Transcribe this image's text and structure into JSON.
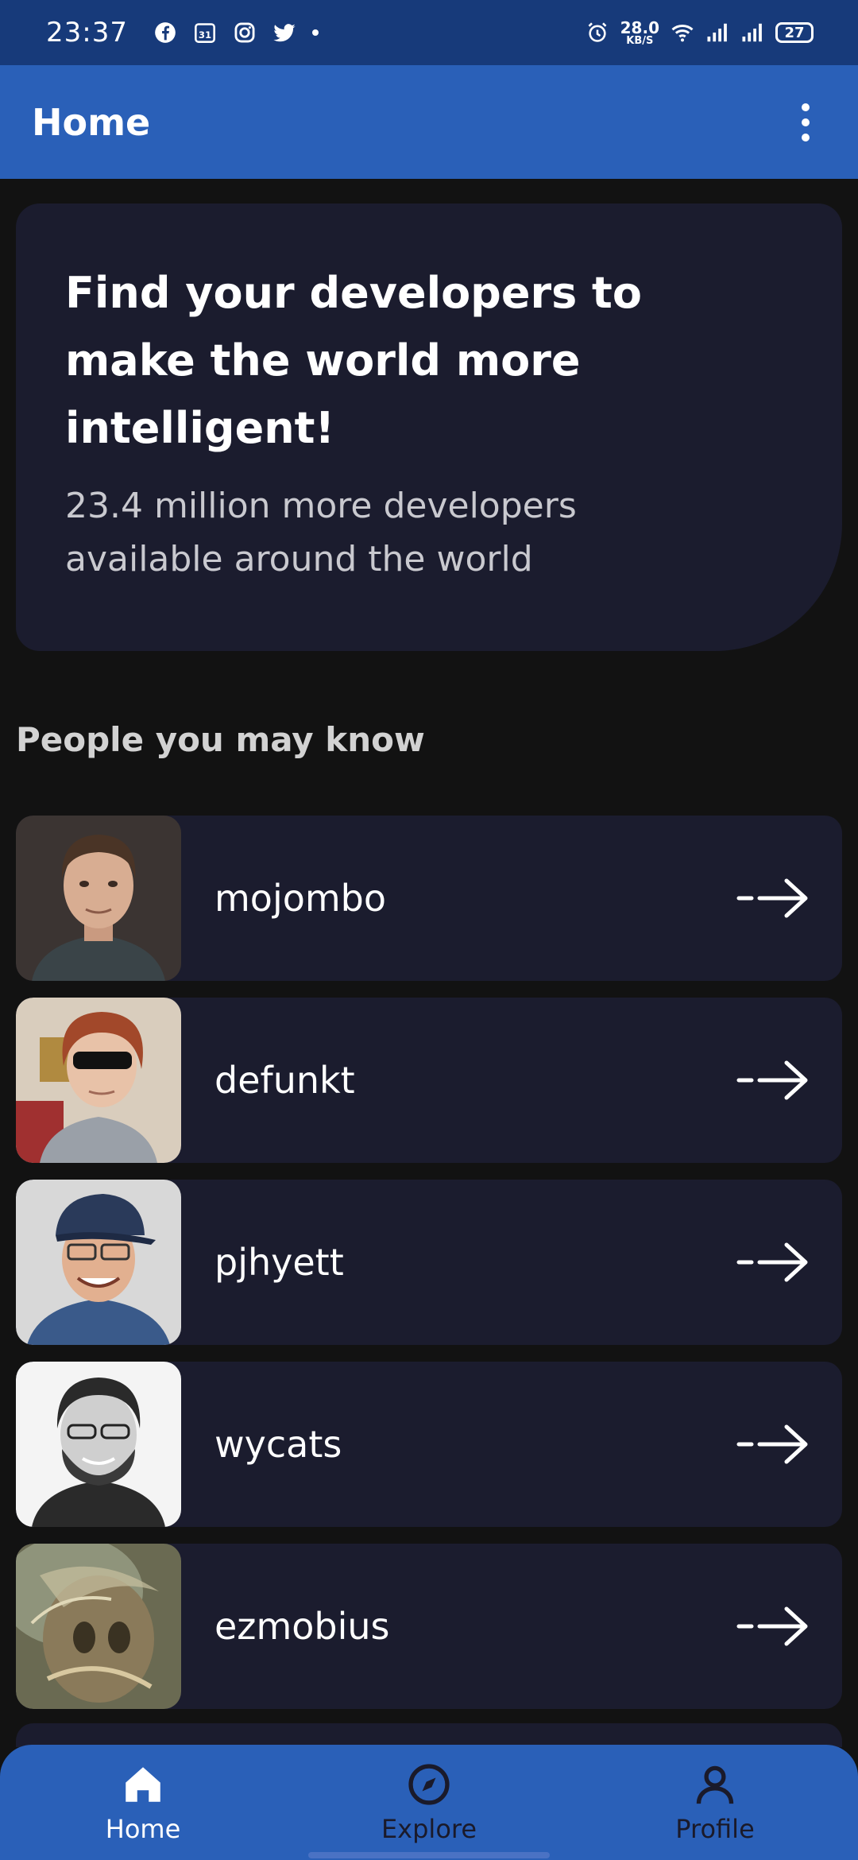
{
  "status_bar": {
    "time": "23:37",
    "speed_value": "28.0",
    "speed_unit": "KB/S",
    "battery": "27",
    "icons": [
      "facebook-icon",
      "calendar-icon",
      "instagram-icon",
      "twitter-icon",
      "alarm-icon",
      "wifi-icon",
      "signal-icon"
    ]
  },
  "app_bar": {
    "title": "Home",
    "menu_icon": "more-vertical-icon"
  },
  "hero": {
    "title": "Find your developers to make the world more intelligent!",
    "subtitle": "23.4 million more developers available around the world"
  },
  "section": {
    "title": "People you may know"
  },
  "people": [
    {
      "username": "mojombo"
    },
    {
      "username": "defunkt"
    },
    {
      "username": "pjhyett"
    },
    {
      "username": "wycats"
    },
    {
      "username": "ezmobius"
    }
  ],
  "bottom_nav": {
    "items": [
      {
        "label": "Home",
        "icon": "home-icon",
        "active": true
      },
      {
        "label": "Explore",
        "icon": "compass-icon",
        "active": false
      },
      {
        "label": "Profile",
        "icon": "person-icon",
        "active": false
      }
    ]
  },
  "colors": {
    "app_bar": "#2a60b8",
    "status_bar": "#173a7a",
    "background": "#121212",
    "card": "#1b1c2e"
  }
}
